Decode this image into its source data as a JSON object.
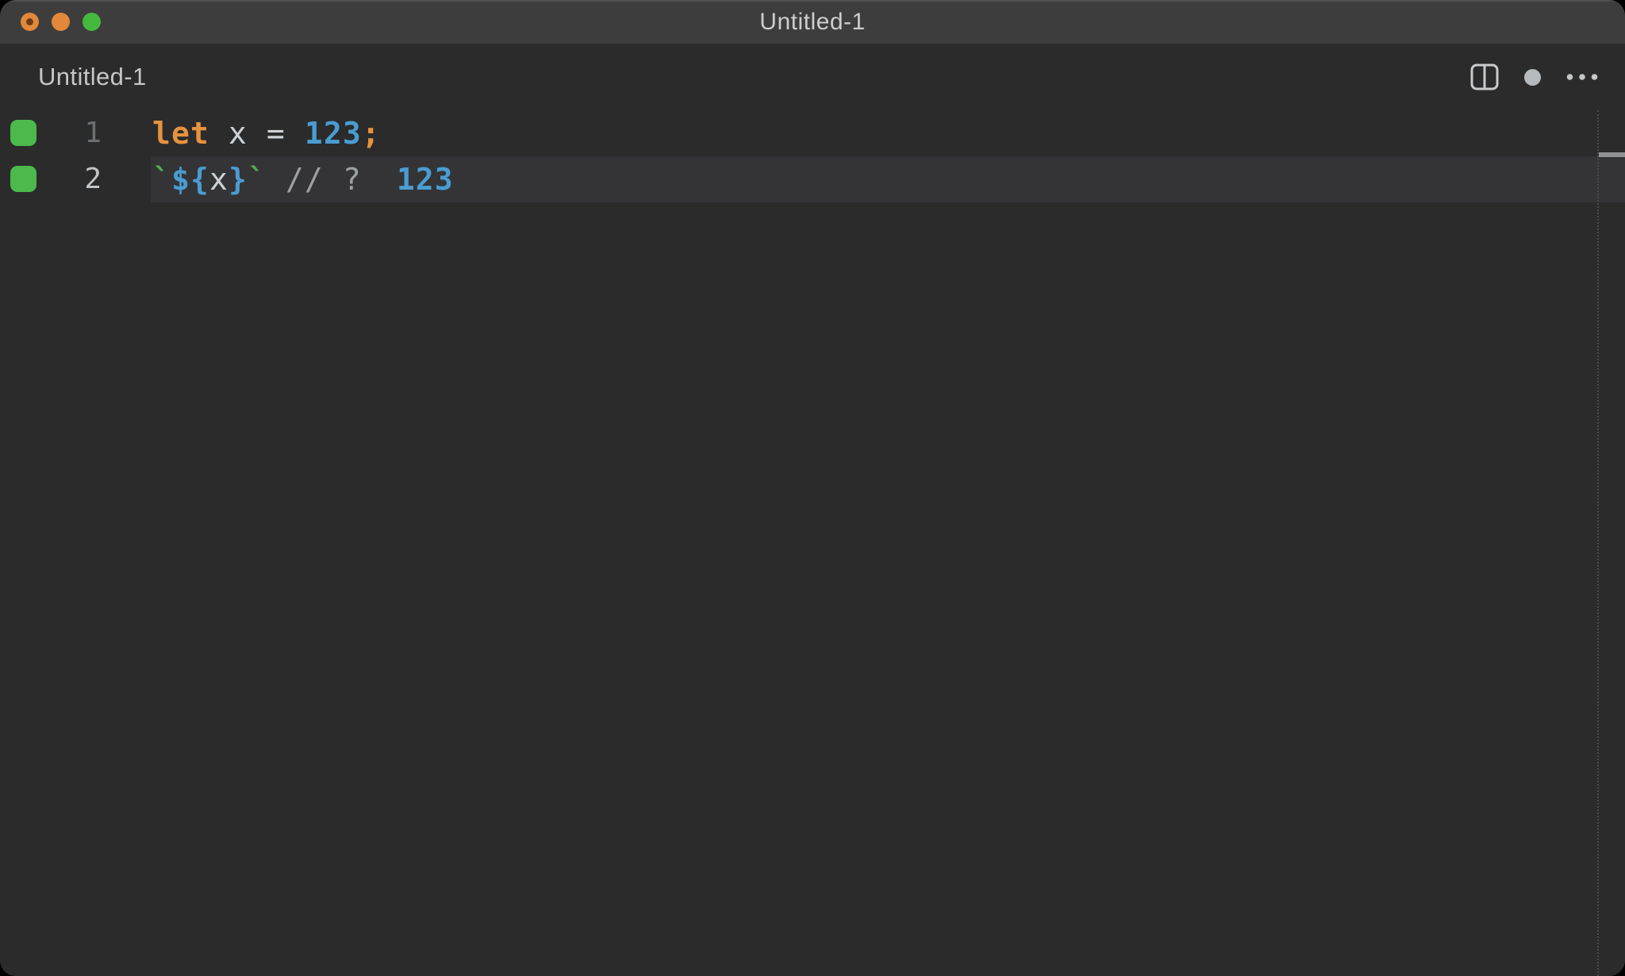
{
  "window": {
    "title": "Untitled-1",
    "traffic_lights": {
      "close_color": "#e2883b",
      "minimize_color": "#e2883b",
      "zoom_color": "#44b93e",
      "close_modified_dot_color": "#6b3c13"
    }
  },
  "header": {
    "tab_label": "Untitled-1",
    "actions": [
      {
        "icon": "split-editor-icon"
      },
      {
        "icon": "modified-dot-icon"
      },
      {
        "icon": "more-actions-icon"
      }
    ]
  },
  "editor": {
    "colors": {
      "background": "#2b2b2b",
      "titlebar": "#3d3d3d",
      "current_line": "#343437",
      "keyword": "#e6923f",
      "number": "#4a9cd2",
      "interpolation": "#4a9cd2",
      "string": "#4fae50",
      "comment": "#9da0a3",
      "foreground": "#ccd1d6",
      "coverage_covered": "#4cb94c",
      "line_number": "#6d7072",
      "line_number_active": "#c2c5c7",
      "overview_cursor_marker": "#8f9193"
    },
    "lines": [
      {
        "number": "1",
        "active": false,
        "coverage": "covered",
        "tokens": [
          {
            "text": "let",
            "type": "keyword"
          },
          {
            "text": " ",
            "type": "foreground"
          },
          {
            "text": "x",
            "type": "foreground"
          },
          {
            "text": " ",
            "type": "foreground"
          },
          {
            "text": "=",
            "type": "foreground"
          },
          {
            "text": " ",
            "type": "foreground"
          },
          {
            "text": "123",
            "type": "number"
          },
          {
            "text": ";",
            "type": "keyword"
          }
        ]
      },
      {
        "number": "2",
        "active": true,
        "coverage": "covered",
        "tokens": [
          {
            "text": "`",
            "type": "string"
          },
          {
            "text": "${",
            "type": "interpolation"
          },
          {
            "text": "x",
            "type": "foreground"
          },
          {
            "text": "}",
            "type": "interpolation"
          },
          {
            "text": "`",
            "type": "string"
          },
          {
            "text": " ",
            "type": "foreground"
          },
          {
            "text": "//",
            "type": "comment"
          },
          {
            "text": " ",
            "type": "foreground"
          },
          {
            "text": "?",
            "type": "comment"
          }
        ],
        "inline_value": "123"
      }
    ]
  }
}
